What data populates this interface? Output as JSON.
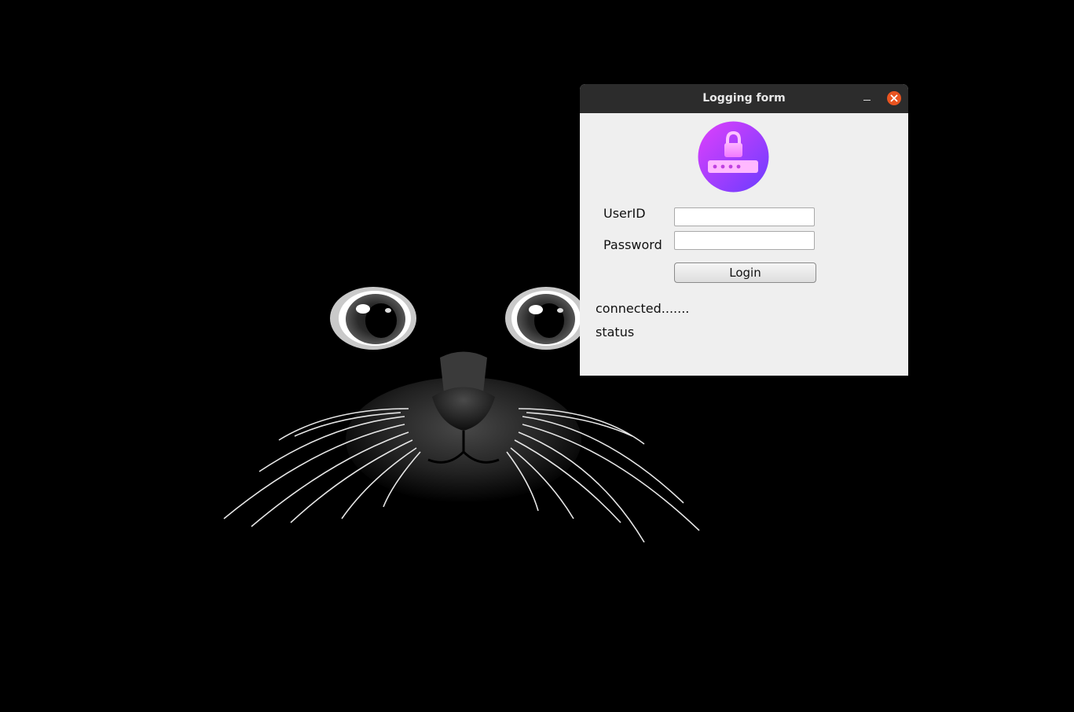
{
  "desktop": {
    "wallpaper_icon": "cat-face-wallpaper",
    "background_color": "#000000"
  },
  "window": {
    "title": "Logging form",
    "minimize_icon": "minimize-icon",
    "close_icon": "close-icon",
    "close_color": "#e95420",
    "titlebar_color": "#2c2c2c",
    "body_color": "#efefef"
  },
  "form": {
    "logo_icon": "lock-password-icon",
    "logo_gradient": [
      "#e040fb",
      "#7c4dff"
    ],
    "userid_label": "UserID",
    "userid_value": "",
    "password_label": "Password",
    "password_value": "",
    "login_label": "Login",
    "connection_text": "connected.......",
    "status_text": "status"
  }
}
